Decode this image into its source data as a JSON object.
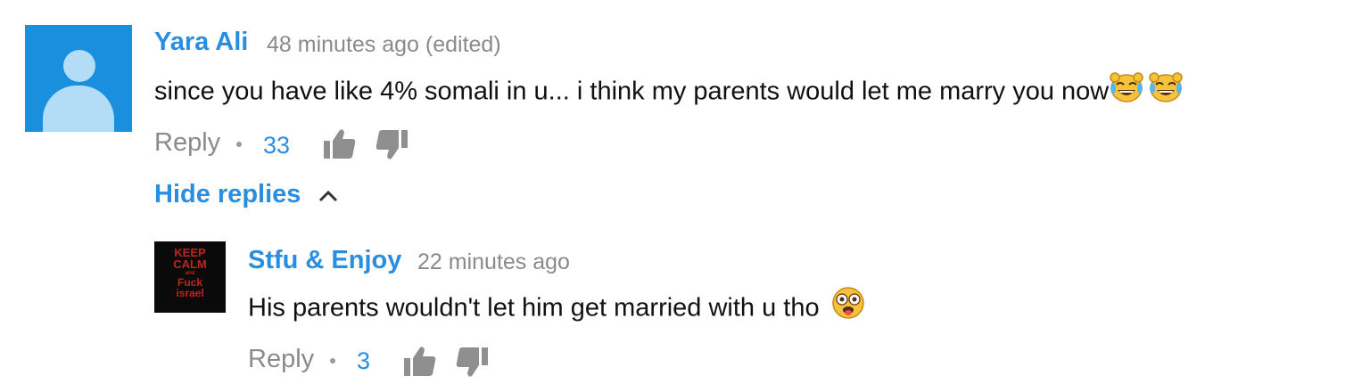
{
  "comment": {
    "author": "Yara Ali",
    "timestamp": "48 minutes ago (edited)",
    "text": "since you have like 4% somali in u... i think my parents would let me marry you now",
    "emojis": [
      "tears-of-joy-emoji",
      "tears-of-joy-emoji"
    ],
    "reply_label": "Reply",
    "likes": "33",
    "hide_replies_label": "Hide replies",
    "avatar": "default-user-avatar"
  },
  "reply": {
    "author": "Stfu & Enjoy",
    "timestamp": "22 minutes ago",
    "text": "His parents wouldn't let him get married with u tho",
    "emojis": [
      "flushed-tongue-emoji"
    ],
    "reply_label": "Reply",
    "likes": "3",
    "avatar_text": [
      "KEEP",
      "CALM",
      "and",
      "Fuck",
      "israel"
    ]
  },
  "colors": {
    "link_blue": "#2a8ee0",
    "meta_gray": "#8a8a8a",
    "text": "#111111",
    "avatar_blue": "#1a8fde",
    "emoji_yellow": "#f5c33b"
  }
}
